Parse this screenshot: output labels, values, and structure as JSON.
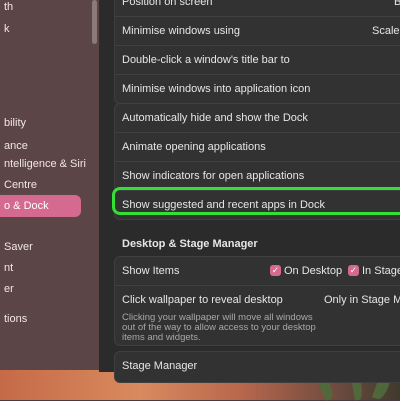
{
  "sidebar": {
    "items": [
      {
        "label": "th"
      },
      {
        "label": "k"
      },
      {
        "label": "bility"
      },
      {
        "label": "ance"
      },
      {
        "label": "ntelligence & Siri"
      },
      {
        "label": "Centre"
      },
      {
        "label": "o & Dock",
        "selected": true
      },
      {
        "label": "Saver"
      },
      {
        "label": "nt"
      },
      {
        "label": "er"
      },
      {
        "label": "tions"
      }
    ]
  },
  "dock": {
    "position_label": "Position on screen",
    "position_value": "B",
    "minimise_label": "Minimise windows using",
    "minimise_value": "Scale",
    "double_click_label": "Double-click a window's title bar to",
    "minimise_icon_label": "Minimise windows into application icon",
    "auto_hide_label": "Automatically hide and show the Dock",
    "animate_label": "Animate opening applications",
    "indicators_label": "Show indicators for open applications",
    "suggested_label": "Show suggested and recent apps in Dock"
  },
  "stage": {
    "section_title": "Desktop & Stage Manager",
    "show_items_label": "Show Items",
    "on_desktop_label": "On Desktop",
    "in_stage_label": "In Stage",
    "click_wallpaper_label": "Click wallpaper to reveal desktop",
    "click_wallpaper_value": "Only in Stage M",
    "click_wallpaper_desc": "Clicking your wallpaper will move all windows out of the way to allow access to your desktop items and widgets.",
    "stage_manager_label": "Stage Manager"
  },
  "colors": {
    "accent": "#d46a8f",
    "highlight": "#35e034"
  }
}
